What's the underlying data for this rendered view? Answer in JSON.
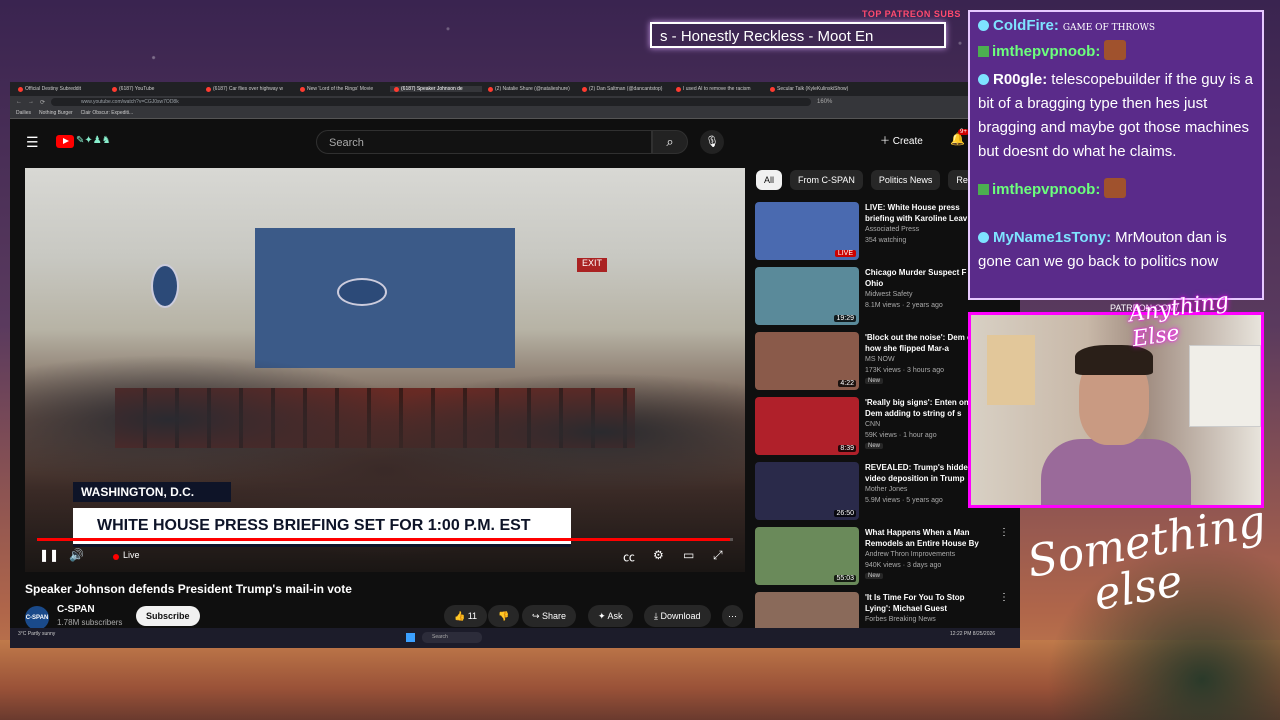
{
  "overlay": {
    "patreon_top": "TOP PATREON SUBS",
    "ticker_text": "s - Honestly Reckless - Moot En",
    "patreon_cam": "PATREON.COM/",
    "anything_else": "Anything Else",
    "something_else_l1": "Something",
    "something_else_l2": "else"
  },
  "browser": {
    "tabs": [
      {
        "label": "Official Destiny Subreddit",
        "active": false
      },
      {
        "label": "(6187) YouTube",
        "active": false
      },
      {
        "label": "(6187) Car flies over highway w",
        "active": false
      },
      {
        "label": "New 'Lord of the Rings' Movie",
        "active": false
      },
      {
        "label": "(6187) Speaker Johnson de",
        "active": true
      },
      {
        "label": "(2) Natalie Shure (@natalieshure)",
        "active": false
      },
      {
        "label": "(2) Dan Saltman (@dancantstop)",
        "active": false
      },
      {
        "label": "I used AI to remove the racism",
        "active": false
      },
      {
        "label": "Secular Talk (KyleKulinskiShow)",
        "active": false
      }
    ],
    "url": "www.youtube.com/watch?v=CGJ0sw7OD8k",
    "zoom": "160%",
    "bookmarks": [
      "Dailies",
      "Nothing Burger",
      "Clair Obscur: Expediti..."
    ]
  },
  "youtube": {
    "search_placeholder": "Search",
    "create_label": "Create",
    "bell_badge": "9+",
    "video": {
      "location_text": "WASHINGTON, D.C.",
      "headline_text": "WHITE HOUSE PRESS BRIEFING SET FOR 1:00 P.M. EST",
      "exit_sign": "EXIT",
      "live_label": "Live",
      "progress": 0.995
    },
    "title": "Speaker Johnson defends President Trump's mail-in vote",
    "channel": {
      "logo_text": "C-SPAN",
      "name": "C-SPAN",
      "subscribers": "1.78M subscribers",
      "subscribe_label": "Subscribe"
    },
    "actions": {
      "likes": "11",
      "share": "Share",
      "ask": "Ask",
      "download": "Download"
    },
    "chips": [
      "All",
      "From C-SPAN",
      "Politics News",
      "Relate"
    ],
    "recommendations": [
      {
        "title": "LIVE: White House press briefing with Karoline Leav",
        "channel": "Associated Press",
        "meta": "354 watching",
        "badge": "",
        "duration": "",
        "live": "LIVE",
        "thumb_color": "#4a6ab0"
      },
      {
        "title": "Chicago Murder Suspect F to Ohio",
        "channel": "Midwest Safety",
        "meta": "8.1M views · 2 years ago",
        "badge": "",
        "duration": "19:29",
        "live": "",
        "thumb_color": "#5a8a9a"
      },
      {
        "title": "'Block out the noise': Dem on how she flipped Mar-a",
        "channel": "MS NOW",
        "meta": "173K views · 3 hours ago",
        "badge": "New",
        "duration": "4:22",
        "live": "",
        "thumb_color": "#8a5a4a"
      },
      {
        "title": "'Really big signs': Enten on Dem adding to string of s",
        "channel": "CNN",
        "meta": "59K views · 1 hour ago",
        "badge": "New",
        "duration": "8:39",
        "live": "",
        "thumb_color": "#b0202a"
      },
      {
        "title": "REVEALED: Trump's hidde video deposition in Trump",
        "channel": "Mother Jones",
        "meta": "5.9M views · 5 years ago",
        "badge": "",
        "duration": "26:50",
        "live": "",
        "thumb_color": "#2a2a4a"
      },
      {
        "title": "What Happens When a Man Remodels an Entire House By ...",
        "channel": "Andrew Thron Improvements",
        "meta": "940K views · 3 days ago",
        "badge": "New",
        "duration": "55:03",
        "live": "",
        "thumb_color": "#6a8a5a"
      },
      {
        "title": "'It Is Time For You To Stop Lying': Michael Guest Explode...",
        "channel": "Forbes Breaking News",
        "meta": "",
        "badge": "",
        "duration": "",
        "live": "",
        "thumb_color": "#8a6a5a"
      }
    ]
  },
  "taskbar": {
    "weather": "3°C Partly sunny",
    "search": "Search",
    "clock": "12:22 PM 8/25/2026"
  },
  "chat": [
    {
      "user": "ColdFire:",
      "text": "GAME OF THROWS",
      "user_color": "cyan",
      "badge": "circle"
    },
    {
      "user": "imthepvpnoob:",
      "text": "",
      "user_color": "green",
      "badge": "k"
    },
    {
      "user": "R00gle:",
      "text": "telescopebuilder if the guy is a bit of a bragging type then hes just bragging and maybe got those machines but doesnt do what he claims.",
      "user_color": "white",
      "badge": "circle"
    },
    {
      "user": "imthepvpnoob:",
      "text": "",
      "user_color": "green",
      "badge": "k"
    },
    {
      "user": "MyName1sTony:",
      "text": "MrMouton dan is gone can we go back to politics now",
      "user_color": "cyan",
      "badge": "circle"
    }
  ]
}
